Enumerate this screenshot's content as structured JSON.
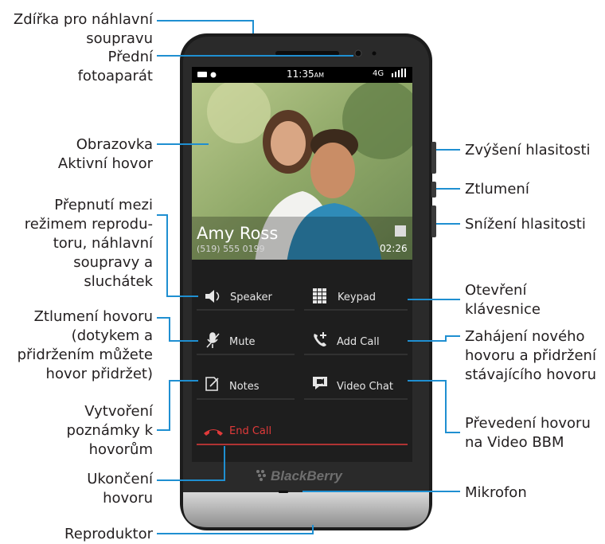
{
  "labels": {
    "headset_jack": "Zdířka pro náhlavní\nsoupravu",
    "front_camera": "Přední\nfotoaparát",
    "screen_active_call": "Obrazovka\nAktivní hovor",
    "speaker_toggle": "Přepnutí mezi\nrežimem reprodu-\ntoru, náhlavní\nsoupravy a\nsluchátek",
    "mute_call": "Ztlumení hovoru\n(dotykem a\npřidržením můžete\nhovor přidržet)",
    "create_notes": "Vytvoření\npoznámky k\nhovorům",
    "end_call": "Ukončení\nhovoru",
    "loudspeaker": "Reproduktor",
    "volume_up": "Zvýšení hlasitosti",
    "mute_key": "Ztlumení",
    "volume_down": "Snížení hlasitosti",
    "open_keypad": "Otevření\nklávesnice",
    "add_call": "Zahájení nového\nhovoru a přidržení\nstávajícího hovoru",
    "video_bbm": "Převedení hovoru\nna Video BBM",
    "microphone": "Mikrofon"
  },
  "screen": {
    "time": "11:35",
    "time_suffix": "AM",
    "network": "4G",
    "contact_name": "Amy Ross",
    "contact_number": "(519) 555 0199",
    "call_duration": "02:26",
    "buttons": {
      "speaker": "Speaker",
      "keypad": "Keypad",
      "mute": "Mute",
      "add_call": "Add Call",
      "notes": "Notes",
      "video_chat": "Video Chat",
      "end_call": "End Call"
    }
  },
  "brand": "BlackBerry",
  "colors": {
    "leader": "#1f8fd1",
    "end_call": "#e03a3a",
    "phone_body": "#1a1a1a",
    "chin": "#b8b8b8"
  }
}
